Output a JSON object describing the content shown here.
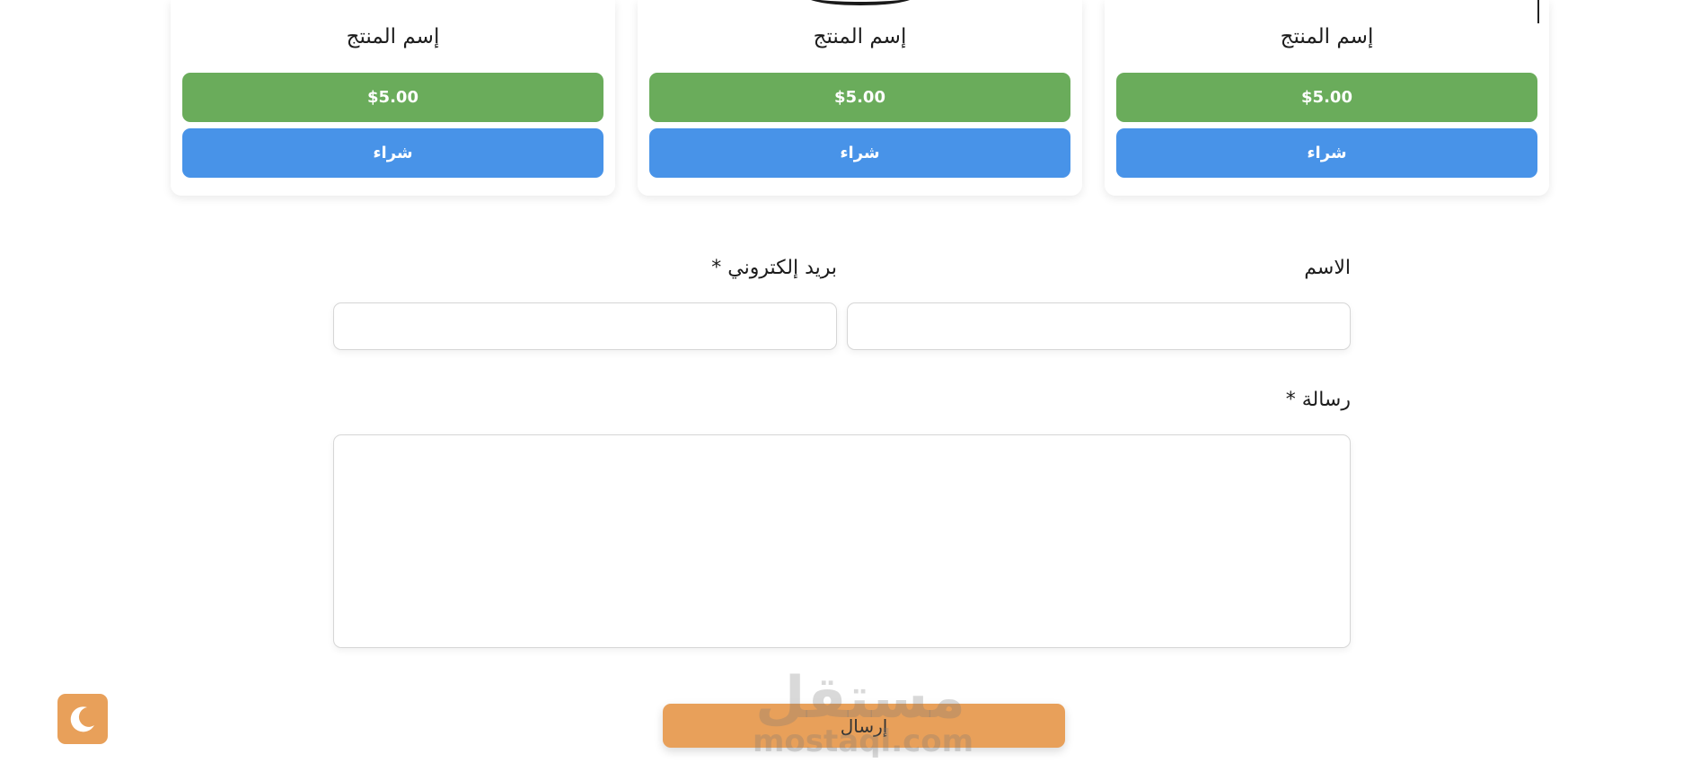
{
  "products": [
    {
      "name": "إسم المنتج",
      "price": "$5.00",
      "buy_label": "شراء"
    },
    {
      "name": "إسم المنتج",
      "price": "$5.00",
      "buy_label": "شراء"
    },
    {
      "name": "إسم المنتج",
      "price": "$5.00",
      "buy_label": "شراء"
    }
  ],
  "form": {
    "name_label": "الاسم",
    "name_value": "",
    "email_label": "بريد إلكتروني *",
    "email_value": "",
    "message_label": "رسالة *",
    "message_value": "",
    "submit_label": "إرسال"
  },
  "watermark": {
    "arabic": "مستقل",
    "latin": "mostaql.com"
  },
  "theme_toggle": {
    "icon": "moon-icon"
  },
  "colors": {
    "price_green": "#6aac5b",
    "buy_blue": "#4893e8",
    "accent_orange": "#e8a05a"
  }
}
